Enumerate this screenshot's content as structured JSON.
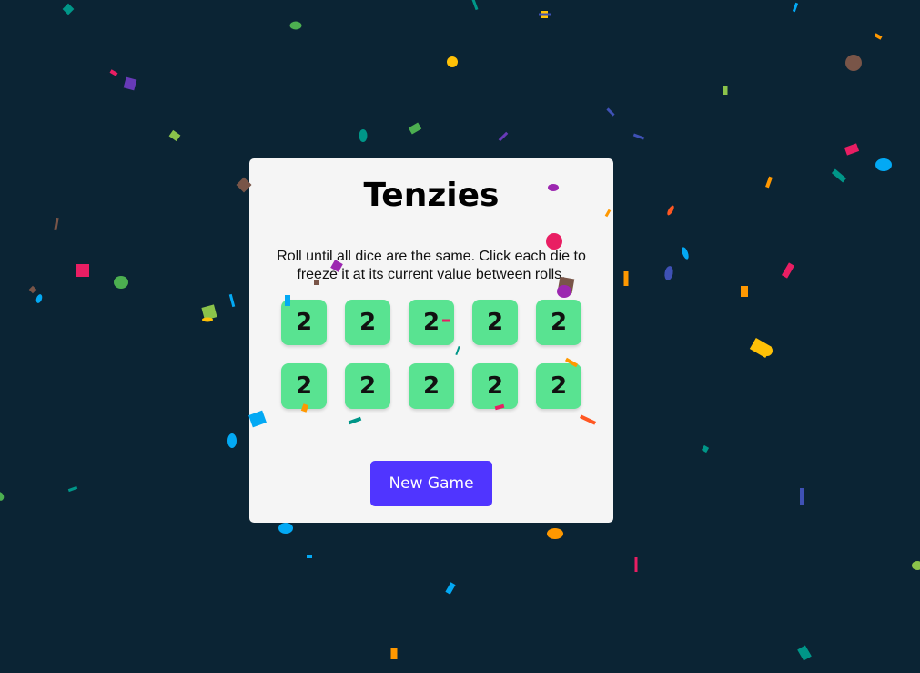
{
  "game": {
    "title": "Tenzies",
    "instructions": "Roll until all dice are the same. Click each die to freeze it at its current value between rolls.",
    "dice": [
      "2",
      "2",
      "2",
      "2",
      "2",
      "2",
      "2",
      "2",
      "2",
      "2"
    ],
    "button_label": "New Game",
    "status": "won"
  },
  "colors": {
    "background": "#0b2434",
    "card": "#f5f5f5",
    "die_held": "#59e391",
    "button": "#5035ff",
    "confetti": [
      "#ffc107",
      "#4caf50",
      "#e91e63",
      "#03a9f4",
      "#9c27b0",
      "#795548",
      "#cddc39",
      "#009688",
      "#673ab7",
      "#ff5722",
      "#3f51b5",
      "#8bc34a",
      "#ff9800"
    ]
  }
}
